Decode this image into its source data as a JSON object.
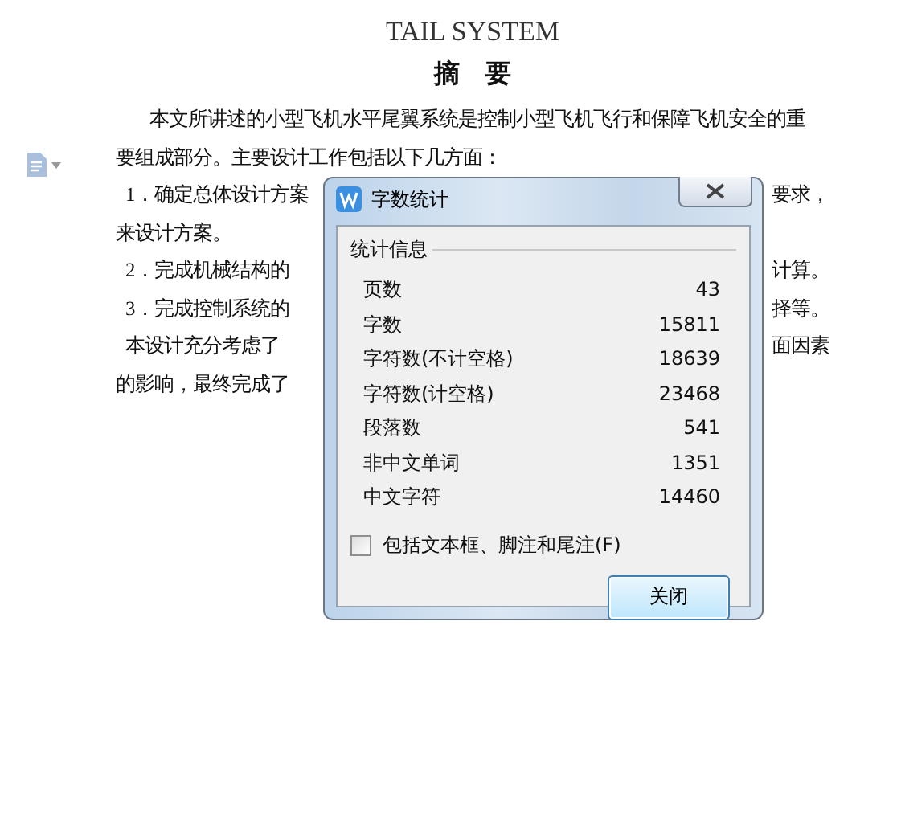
{
  "document": {
    "title": "TAIL SYSTEM",
    "heading": "摘　要",
    "lines": [
      {
        "kind": "indent",
        "left": "本文所讲述的小型飞机水平尾翼系统是控制小型飞机飞行和保障飞机安全的重"
      },
      {
        "kind": "plain",
        "left": "要组成部分。主要设计工作包括以下几方面："
      },
      {
        "kind": "item",
        "left": "1．确定总体设计方案",
        "right": "要求，"
      },
      {
        "kind": "plain",
        "left": "来设计方案。"
      },
      {
        "kind": "item",
        "left": "2．完成机械结构的",
        "right": "计算。"
      },
      {
        "kind": "item",
        "left": "3．完成控制系统的",
        "right": "择等。"
      },
      {
        "kind": "item",
        "left": "本设计充分考虑了",
        "right": "面因素"
      },
      {
        "kind": "plain",
        "left": "的影响，最终完成了"
      }
    ]
  },
  "dialog": {
    "title": "字数统计",
    "group": "统计信息",
    "stats": [
      {
        "label": "页数",
        "value": "43"
      },
      {
        "label": "字数",
        "value": "15811"
      },
      {
        "label": "字符数(不计空格)",
        "value": "18639"
      },
      {
        "label": "字符数(计空格)",
        "value": "23468"
      },
      {
        "label": "段落数",
        "value": "541"
      },
      {
        "label": "非中文单词",
        "value": "1351"
      },
      {
        "label": "中文字符",
        "value": "14460"
      }
    ],
    "include_option": {
      "label": "包括文本框、脚注和尾注(F)",
      "checked": false
    },
    "close_button": "关闭"
  }
}
